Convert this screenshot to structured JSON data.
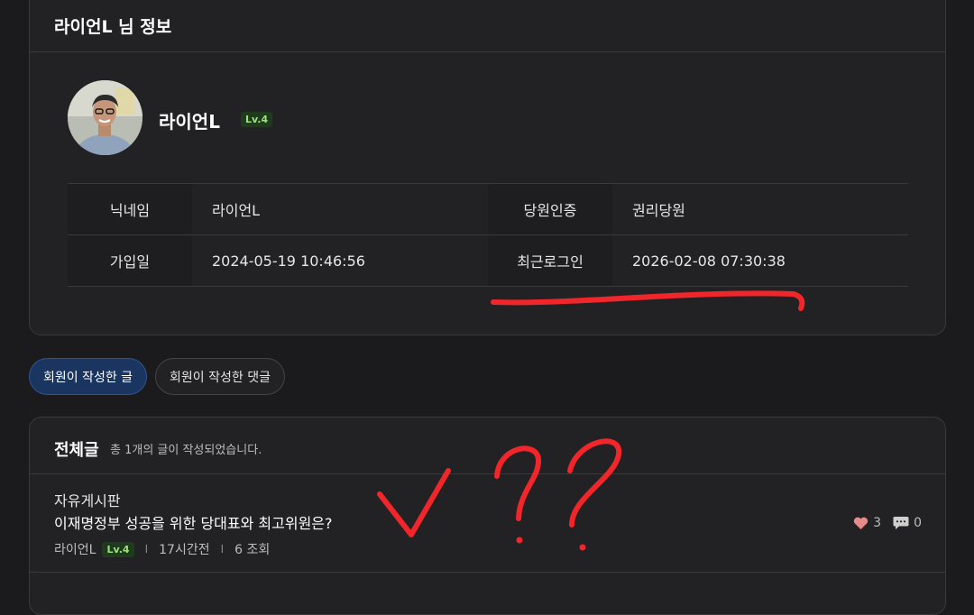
{
  "profile": {
    "card_title": "라이언L 님 정보",
    "name": "라이언L",
    "level": "Lv.4",
    "info": {
      "nickname_label": "닉네임",
      "nickname_value": "라이언L",
      "verify_label": "당원인증",
      "verify_value": "권리당원",
      "joined_label": "가입일",
      "joined_value": "2024-05-19 10:46:56",
      "lastlogin_label": "최근로그인",
      "lastlogin_value": "2026-02-08 07:30:38"
    }
  },
  "tabs": {
    "posts": "회원이 작성한 글",
    "comments": "회원이 작성한 댓글",
    "active": "posts"
  },
  "posts": {
    "title": "전체글",
    "count_text": "총 1개의 글이 작성되었습니다.",
    "items": [
      {
        "board": "자유게시판",
        "title": "이재명정부 성공을 위한 당대표와 최고위원은?",
        "author": "라이언L",
        "level": "Lv.4",
        "time": "17시간전",
        "views": "6 조회",
        "likes": "3",
        "comments": "0"
      }
    ]
  },
  "annotation": {
    "check_mark": "V",
    "question_marks": "??"
  },
  "colors": {
    "background": "#1b1b1d",
    "card": "#222224",
    "active_tab": "#1b3561",
    "level_badge_bg": "#1e3b1e",
    "level_badge_text": "#9fe07a",
    "like_heart": "#e78a8a",
    "annotation_red": "#f0262b"
  },
  "icons": [
    "avatar-photo",
    "heart-icon",
    "comment-bubble-icon"
  ]
}
